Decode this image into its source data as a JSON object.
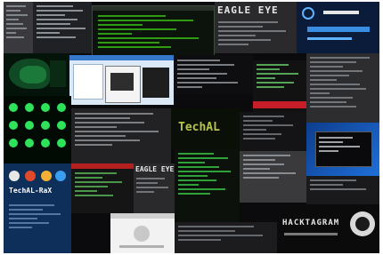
{
  "tiles": {
    "eagle_eye_top": {
      "title": "EAGLE EYE"
    },
    "eagle_eye_mid": {
      "title": "EAGLE EYE"
    },
    "sqlmap_green": {
      "title": "TechAL"
    },
    "techall_logo": {
      "title": "TechAL-RaX"
    },
    "bottom_banner": {
      "title": "HACKTAGRAM"
    }
  },
  "colors": {
    "terminal_green": "#39ff14",
    "terminal_red": "#d22020",
    "terminal_bg": "#0d0f0d",
    "desktop_blue": "#1e6fd9",
    "panel_gray": "#2b2b2e"
  }
}
